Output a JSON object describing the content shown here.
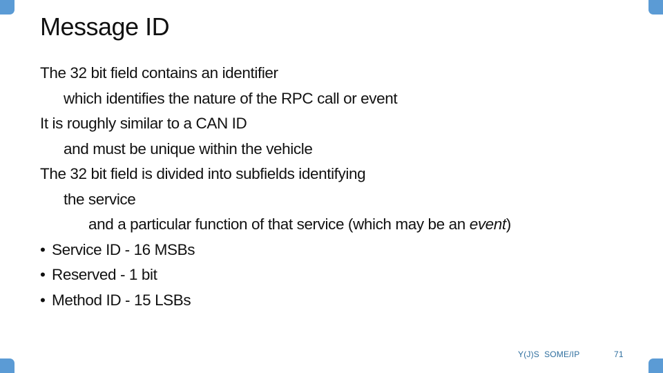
{
  "slide": {
    "title": "Message ID",
    "lines": [
      {
        "level": 0,
        "text": "The 32 bit field contains an identifier"
      },
      {
        "level": 1,
        "text": "which identifies the nature of the RPC call or event"
      },
      {
        "level": 0,
        "text": "It is roughly similar to a CAN ID"
      },
      {
        "level": 1,
        "text": "and must be unique within the vehicle"
      },
      {
        "level": 0,
        "text": "The 32 bit field is divided into subfields identifying"
      },
      {
        "level": 1,
        "text": "the service"
      },
      {
        "level": 2,
        "text_before": "and a particular function of that service (which may be an ",
        "text_italic": "event",
        "text_after": ")"
      }
    ],
    "bullets": [
      "Service ID - 16 MSBs",
      "Reserved - 1 bit",
      "Method ID - 15 LSBs"
    ],
    "bullet_glyph": "•"
  },
  "footer": {
    "title": "Y(J)S  SOME/IP",
    "page_number": "71"
  },
  "colors": {
    "accent": "#5b9bd5",
    "footer_text": "#2e6e9e"
  }
}
